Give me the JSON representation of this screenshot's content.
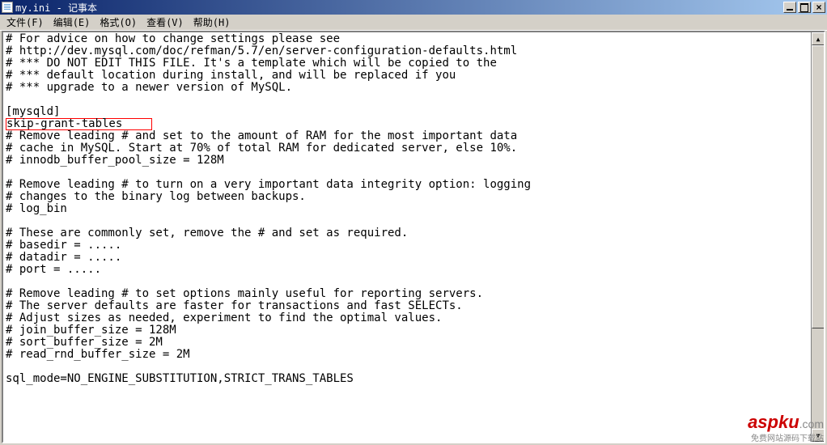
{
  "window": {
    "title": "my.ini - 记事本"
  },
  "menu": {
    "file": "文件(F)",
    "edit": "编辑(E)",
    "format": "格式(O)",
    "view": "查看(V)",
    "help": "帮助(H)"
  },
  "editor": {
    "highlighted_text": "skip-grant-tables",
    "lines": [
      "# For advice on how to change settings please see",
      "# http://dev.mysql.com/doc/refman/5.7/en/server-configuration-defaults.html",
      "# *** DO NOT EDIT THIS FILE. It's a template which will be copied to the",
      "# *** default location during install, and will be replaced if you",
      "# *** upgrade to a newer version of MySQL.",
      "",
      "[mysqld]",
      "__HIGHLIGHT__",
      "# Remove leading # and set to the amount of RAM for the most important data",
      "# cache in MySQL. Start at 70% of total RAM for dedicated server, else 10%.",
      "# innodb_buffer_pool_size = 128M",
      "",
      "# Remove leading # to turn on a very important data integrity option: logging",
      "# changes to the binary log between backups.",
      "# log_bin",
      "",
      "# These are commonly set, remove the # and set as required.",
      "# basedir = .....",
      "# datadir = .....",
      "# port = .....",
      "",
      "# Remove leading # to set options mainly useful for reporting servers.",
      "# The server defaults are faster for transactions and fast SELECTs.",
      "# Adjust sizes as needed, experiment to find the optimal values.",
      "# join_buffer_size = 128M",
      "# sort_buffer_size = 2M",
      "# read_rnd_buffer_size = 2M",
      "",
      "sql_mode=NO_ENGINE_SUBSTITUTION,STRICT_TRANS_TABLES"
    ]
  },
  "watermark": {
    "main_red": "aspku",
    "main_gray": ".com",
    "sub": "免费网站源码下载站"
  }
}
